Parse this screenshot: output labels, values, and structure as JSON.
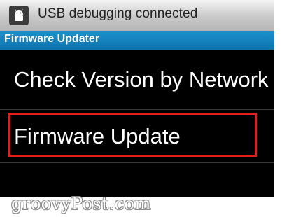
{
  "statusbar": {
    "icon": "android-usb-debug-icon",
    "text": "USB debugging connected"
  },
  "titlebar": {
    "title": "Firmware Updater",
    "color": "#1487c2"
  },
  "menu": {
    "items": [
      {
        "label": "Check Version by Network"
      },
      {
        "label": "Firmware Update",
        "highlighted": true
      }
    ]
  },
  "annotation": {
    "highlight_color": "#e41d1d"
  },
  "watermark": "groovyPost.com"
}
